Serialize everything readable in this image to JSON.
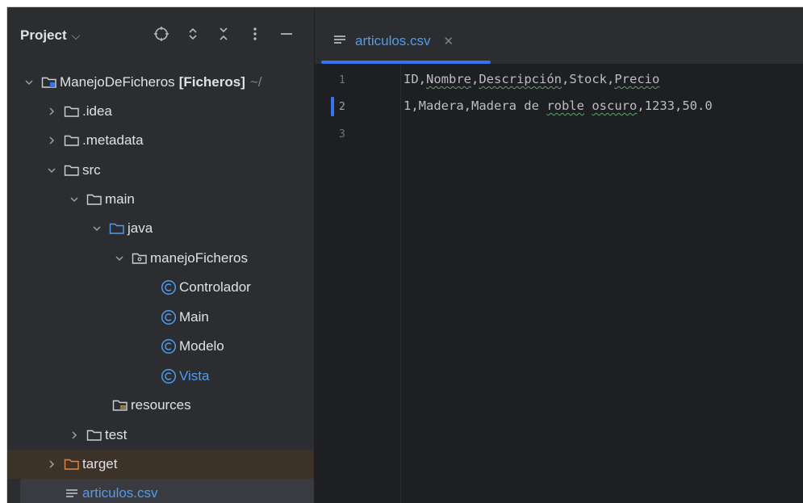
{
  "project": {
    "title": "Project",
    "tree": [
      {
        "label": "ManejoDeFicheros",
        "extra": "[Ficheros]",
        "suffix": "~/"
      },
      {
        "label": ".idea"
      },
      {
        "label": ".metadata"
      },
      {
        "label": "src"
      },
      {
        "label": "main"
      },
      {
        "label": "java"
      },
      {
        "label": "manejoFicheros"
      },
      {
        "label": "Controlador"
      },
      {
        "label": "Main"
      },
      {
        "label": "Modelo"
      },
      {
        "label": "Vista"
      },
      {
        "label": "resources"
      },
      {
        "label": "test"
      },
      {
        "label": "target"
      },
      {
        "label": "articulos.csv"
      }
    ]
  },
  "editor": {
    "tab": {
      "label": "articulos.csv"
    },
    "line_numbers": [
      "1",
      "2",
      "3"
    ],
    "lines": [
      {
        "parts": [
          "ID,",
          "Nombre",
          ",",
          "Descripción",
          ",Stock,",
          "Precio"
        ]
      },
      {
        "parts": [
          "1,Madera,Madera de ",
          "roble",
          " ",
          "oscuro",
          ",1233,50.0"
        ]
      }
    ]
  },
  "colors": {
    "accent": "#3574f0",
    "link_blue": "#4e9cf3",
    "panel_bg": "#2b2d30",
    "editor_bg": "#1e1f22",
    "spellcheck": "#5fa36a"
  }
}
